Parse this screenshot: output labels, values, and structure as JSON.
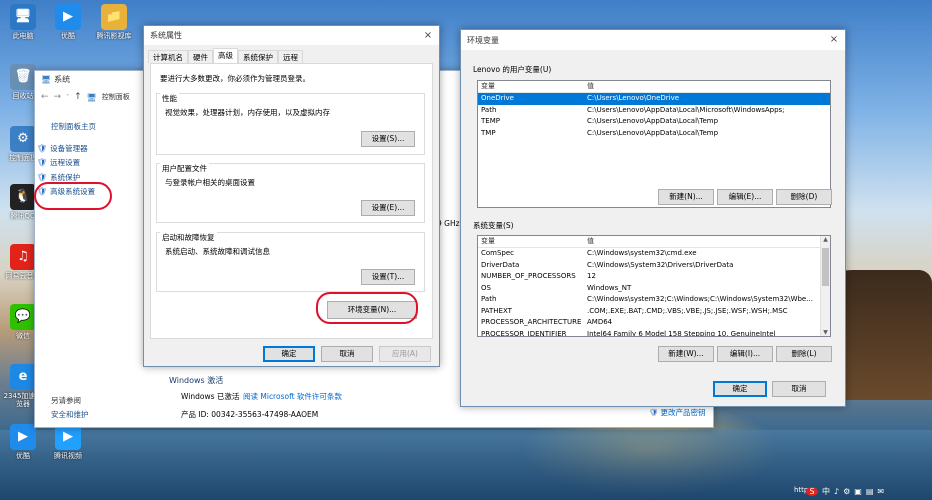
{
  "desktop": {
    "icons": [
      {
        "label": "此电脑",
        "glyph": "🖥",
        "color": "#2b78c5"
      },
      {
        "label": "优酷",
        "glyph": "▶",
        "color": "#1f8ceb"
      },
      {
        "label": "腾讯影视库",
        "glyph": "📁",
        "color": "#e8b23a"
      },
      {
        "label": "回收站",
        "glyph": "🗑",
        "color": "#6a8fb5"
      },
      {
        "label": "控制面板",
        "glyph": "⚙",
        "color": "#3b7fc4"
      },
      {
        "label": "腾讯QQ",
        "glyph": "🐧",
        "color": "#222222"
      },
      {
        "label": "网易云音乐",
        "glyph": "♫",
        "color": "#e2231a"
      },
      {
        "label": "微信",
        "glyph": "💬",
        "color": "#2dc100"
      },
      {
        "label": "2345加速浏览器",
        "glyph": "e",
        "color": "#1e88e5"
      },
      {
        "label": "优酷",
        "glyph": "▶",
        "color": "#1f8ceb"
      },
      {
        "label": "腾讯视频",
        "glyph": "▶",
        "color": "#20a0ff"
      }
    ]
  },
  "system_window": {
    "title": "系统",
    "nav_path": "控制面板",
    "home_link": "控制面板主页",
    "sidebar_items": [
      "设备管理器",
      "远程设置",
      "系统保护",
      "高级系统设置"
    ],
    "see_also_title": "另请参阅",
    "see_also_item": "安全和维护",
    "ghz_fragment": "9 GHz",
    "activation_heading": "Windows 激活",
    "activation_status": "Windows 已激活",
    "activation_link": "阅读 Microsoft 软件许可条款",
    "product_id": "产品 ID: 00342-35563-47498-AAOEM",
    "change_key": "更改产品密钥"
  },
  "sysprops_dialog": {
    "title": "系统属性",
    "close_glyph": "×",
    "tabs": [
      "计算机名",
      "硬件",
      "高级",
      "系统保护",
      "远程"
    ],
    "active_tab": "高级",
    "intro": "要进行大多数更改，你必须作为管理员登录。",
    "perf_title": "性能",
    "perf_desc": "视觉效果，处理器计划，内存使用，以及虚拟内存",
    "perf_btn": "设置(S)...",
    "profile_title": "用户配置文件",
    "profile_desc": "与登录帐户相关的桌面设置",
    "profile_btn": "设置(E)...",
    "startup_title": "启动和故障恢复",
    "startup_desc": "系统启动、系统故障和调试信息",
    "startup_btn": "设置(T)...",
    "envvars_btn": "环境变量(N)...",
    "ok": "确定",
    "cancel": "取消",
    "apply": "应用(A)"
  },
  "envvars_dialog": {
    "title": "环境变量",
    "close_glyph": "×",
    "user_section": "Lenovo 的用户变量(U)",
    "col_var": "变量",
    "col_val": "值",
    "user_vars": [
      {
        "name": "OneDrive",
        "value": "C:\\Users\\Lenovo\\OneDrive"
      },
      {
        "name": "Path",
        "value": "C:\\Users\\Lenovo\\AppData\\Local\\Microsoft\\WindowsApps;"
      },
      {
        "name": "TEMP",
        "value": "C:\\Users\\Lenovo\\AppData\\Local\\Temp"
      },
      {
        "name": "TMP",
        "value": "C:\\Users\\Lenovo\\AppData\\Local\\Temp"
      }
    ],
    "user_selected": 0,
    "user_new": "新建(N)...",
    "user_edit": "编辑(E)...",
    "user_delete": "删除(D)",
    "sys_section": "系统变量(S)",
    "sys_vars": [
      {
        "name": "ComSpec",
        "value": "C:\\Windows\\system32\\cmd.exe"
      },
      {
        "name": "DriverData",
        "value": "C:\\Windows\\System32\\Drivers\\DriverData"
      },
      {
        "name": "NUMBER_OF_PROCESSORS",
        "value": "12"
      },
      {
        "name": "OS",
        "value": "Windows_NT"
      },
      {
        "name": "Path",
        "value": "C:\\Windows\\system32;C:\\Windows;C:\\Windows\\System32\\Wbe..."
      },
      {
        "name": "PATHEXT",
        "value": ".COM;.EXE;.BAT;.CMD;.VBS;.VBE;.JS;.JSE;.WSF;.WSH;.MSC"
      },
      {
        "name": "PROCESSOR_ARCHITECTURE",
        "value": "AMD64"
      },
      {
        "name": "PROCESSOR_IDENTIFIER",
        "value": "Intel64 Family 6 Model 158 Stepping 10, GenuineIntel"
      }
    ],
    "sys_new": "新建(W)...",
    "sys_edit": "编辑(I)...",
    "sys_delete": "删除(L)",
    "ok": "确定",
    "cancel": "取消"
  },
  "taskbar_tray": {
    "watermark": "https",
    "ime": "中",
    "icons": [
      "S",
      "中",
      "♪",
      "⚙",
      "▣",
      "▤",
      "✉"
    ]
  },
  "colors": {
    "selection": "#0078d7",
    "annotation": "#e0102a",
    "link": "#0066cc"
  }
}
